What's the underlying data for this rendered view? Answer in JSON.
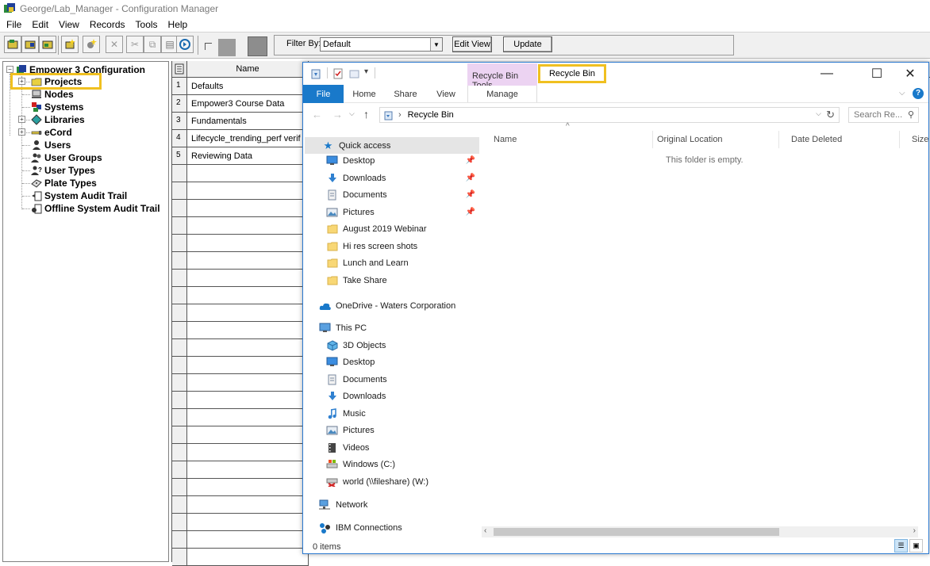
{
  "app": {
    "title": "George/Lab_Manager - Configuration Manager",
    "menu": [
      "File",
      "Edit",
      "View",
      "Records",
      "Tools",
      "Help"
    ],
    "filter_label": "Filter By:",
    "filter_value": "Default",
    "edit_view_label": "Edit View",
    "update_label": "Update"
  },
  "tree": {
    "root": "Empower 3 Configuration",
    "items": [
      {
        "label": "Projects",
        "icon": "projects-folder-icon"
      },
      {
        "label": "Nodes",
        "icon": "nodes-icon"
      },
      {
        "label": "Systems",
        "icon": "systems-icon"
      },
      {
        "label": "Libraries",
        "icon": "libraries-icon"
      },
      {
        "label": "eCord",
        "icon": "ecord-icon"
      },
      {
        "label": "Users",
        "icon": "user-icon"
      },
      {
        "label": "User Groups",
        "icon": "user-groups-icon"
      },
      {
        "label": "User Types",
        "icon": "user-types-icon"
      },
      {
        "label": "Plate Types",
        "icon": "plate-types-icon"
      },
      {
        "label": "System Audit Trail",
        "icon": "audit-trail-icon"
      },
      {
        "label": "Offline System Audit Trail",
        "icon": "offline-audit-trail-icon"
      }
    ]
  },
  "grid": {
    "column": "Name",
    "rows": [
      {
        "num": "1",
        "name": "Defaults"
      },
      {
        "num": "2",
        "name": "Empower3 Course Data"
      },
      {
        "num": "3",
        "name": "Fundamentals"
      },
      {
        "num": "4",
        "name": "Lifecycle_trending_perf verif"
      },
      {
        "num": "5",
        "name": "Reviewing Data"
      }
    ]
  },
  "explorer": {
    "window_title": "Recycle Bin",
    "context_tab": "Recycle Bin Tools",
    "ribbon_tabs": [
      "File",
      "Home",
      "Share",
      "View"
    ],
    "manage_tab": "Manage",
    "address": "Recycle Bin",
    "search_placeholder": "Search Re...",
    "columns": [
      "Name",
      "Original Location",
      "Date Deleted",
      "Size"
    ],
    "empty_message": "This folder is empty.",
    "status": "0 items",
    "nav": {
      "quick_access": "Quick access",
      "quick_items": [
        {
          "label": "Desktop",
          "icon": "desktop-icon",
          "pinned": true
        },
        {
          "label": "Downloads",
          "icon": "downloads-icon",
          "pinned": true
        },
        {
          "label": "Documents",
          "icon": "documents-icon",
          "pinned": true
        },
        {
          "label": "Pictures",
          "icon": "pictures-icon",
          "pinned": true
        },
        {
          "label": "August 2019 Webinar",
          "icon": "folder-icon",
          "pinned": false
        },
        {
          "label": "Hi res screen shots",
          "icon": "folder-icon",
          "pinned": false
        },
        {
          "label": "Lunch and Learn",
          "icon": "folder-icon",
          "pinned": false
        },
        {
          "label": "Take Share",
          "icon": "folder-icon",
          "pinned": false
        }
      ],
      "onedrive": "OneDrive - Waters Corporation",
      "this_pc": "This PC",
      "pc_items": [
        {
          "label": "3D Objects",
          "icon": "3d-objects-icon"
        },
        {
          "label": "Desktop",
          "icon": "desktop-icon"
        },
        {
          "label": "Documents",
          "icon": "documents-icon"
        },
        {
          "label": "Downloads",
          "icon": "downloads-icon"
        },
        {
          "label": "Music",
          "icon": "music-icon"
        },
        {
          "label": "Pictures",
          "icon": "pictures-icon"
        },
        {
          "label": "Videos",
          "icon": "videos-icon"
        },
        {
          "label": "Windows (C:)",
          "icon": "drive-icon"
        },
        {
          "label": "world (\\\\fileshare) (W:)",
          "icon": "network-drive-icon"
        }
      ],
      "network": "Network",
      "ibm": "IBM Connections"
    }
  },
  "colors": {
    "highlight": "#f0c020",
    "file_tab": "#1979ca",
    "context_tab": "#ecd3f2"
  }
}
